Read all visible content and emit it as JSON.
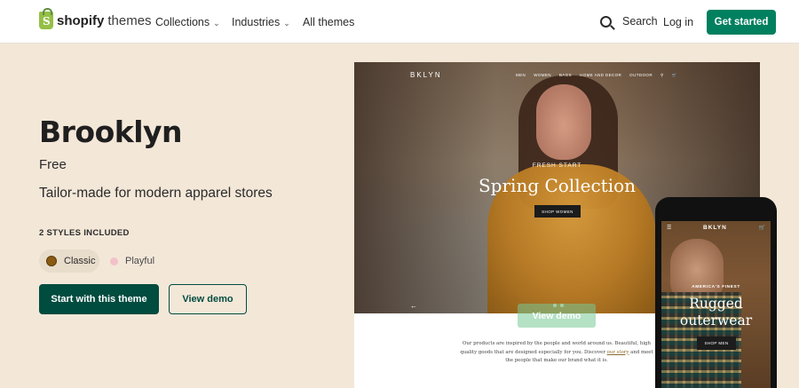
{
  "nav": {
    "brand": "shopify",
    "brand_suffix": "themes",
    "links": [
      {
        "label": "Collections"
      },
      {
        "label": "Industries"
      },
      {
        "label": "All themes"
      }
    ],
    "search_label": "Search",
    "login_label": "Log in",
    "cta_label": "Get started"
  },
  "theme": {
    "name": "Brooklyn",
    "price": "Free",
    "tagline": "Tailor-made for modern apparel stores",
    "styles_heading": "2 STYLES INCLUDED",
    "styles": [
      {
        "label": "Classic",
        "color": "#8a5a12",
        "selected": true
      },
      {
        "label": "Playful",
        "color": "#f3c1c9",
        "selected": false
      }
    ],
    "primary_cta": "Start with this theme",
    "secondary_cta": "View demo"
  },
  "preview": {
    "desktop": {
      "logo": "BKLYN",
      "nav_links": [
        "MEN",
        "WOMEN",
        "BAGS",
        "HOME AND DECOR",
        "OUTDOOR"
      ],
      "kicker": "FRESH START",
      "headline": "Spring Collection",
      "button": "SHOP WOMEN",
      "hover_label": "View demo",
      "body_before": "Our products are inspired by the people and world around us. Beautiful, high quality goods that are designed especially for you. Discover ",
      "body_link": "our story",
      "body_after": " and meet the people that make our brand what it is."
    },
    "mobile": {
      "logo": "BKLYN",
      "kicker": "AMERICA'S FINEST",
      "headline_line1": "Rugged",
      "headline_line2": "outerwear",
      "button": "SHOP MEN"
    }
  },
  "colors": {
    "brand_green": "#00805f",
    "dark_green": "#004c3f",
    "hero_bg": "#f3e7d8",
    "logo_green": "#95bf47"
  }
}
